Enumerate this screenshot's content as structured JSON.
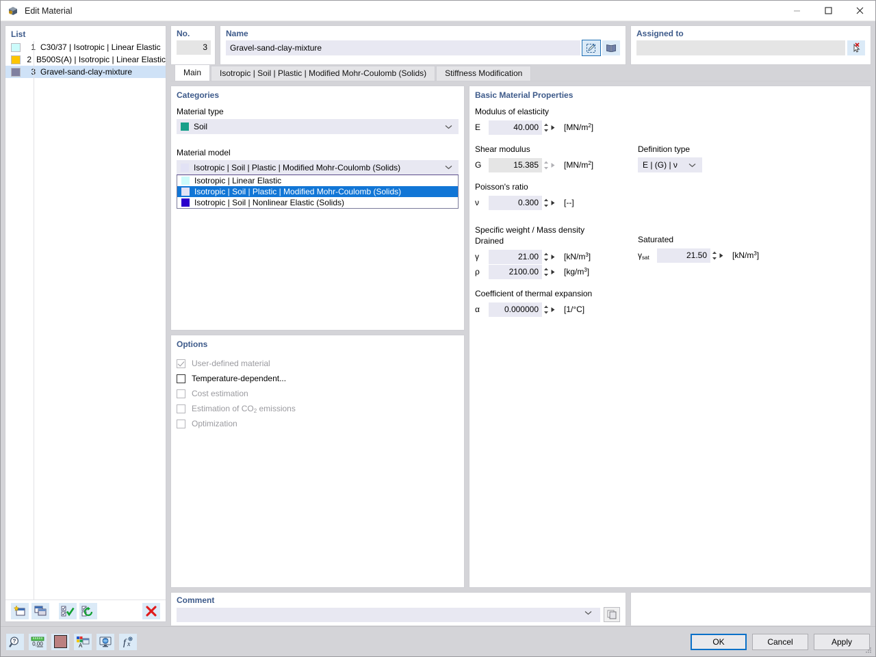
{
  "window": {
    "title": "Edit Material",
    "icon": "material-cube-icon",
    "controls": {
      "minimize": "—",
      "maximize": "☐",
      "close": "✕"
    }
  },
  "list_panel": {
    "caption": "List",
    "rows": [
      {
        "no": "1",
        "label": "C30/37 | Isotropic | Linear Elastic",
        "color": "#ccfbfb"
      },
      {
        "no": "2",
        "label": "B500S(A) | Isotropic | Linear Elastic",
        "color": "#fdc500"
      },
      {
        "no": "3",
        "label": "Gravel-sand-clay-mixture",
        "color": "#8080a0"
      }
    ],
    "selected_index": 2,
    "toolbar": [
      {
        "name": "new-material-button",
        "icon": "new-window-star-icon"
      },
      {
        "name": "copy-material-button",
        "icon": "copy-windows-icon"
      },
      {
        "name": "select-all-button",
        "icon": "checklist-check-icon"
      },
      {
        "name": "invert-selection-button",
        "icon": "checklist-refresh-icon"
      },
      {
        "name": "delete-material-button",
        "icon": "red-x-icon",
        "glyph": "✕"
      }
    ]
  },
  "header": {
    "no": {
      "caption": "No.",
      "value": "3"
    },
    "name": {
      "caption": "Name",
      "value": "Gravel-sand-clay-mixture",
      "placeholder": "",
      "buttons": [
        {
          "name": "edit-name-button",
          "icon": "pencil-edit-icon"
        },
        {
          "name": "material-library-button",
          "icon": "book-library-icon"
        }
      ]
    },
    "assigned_to": {
      "caption": "Assigned to",
      "value": "",
      "button": {
        "name": "clear-assignment-button",
        "icon": "cursor-red-x-icon"
      }
    }
  },
  "tabs": [
    {
      "label": "Main",
      "active": true
    },
    {
      "label": "Isotropic | Soil | Plastic | Modified Mohr-Coulomb (Solids)",
      "active": false
    },
    {
      "label": "Stiffness Modification",
      "active": false
    }
  ],
  "categories": {
    "caption": "Categories",
    "material_type": {
      "label": "Material type",
      "value": "Soil",
      "swatch": "#17a08a"
    },
    "material_model": {
      "label": "Material model",
      "value": "Isotropic | Soil | Plastic | Modified Mohr-Coulomb (Solids)",
      "swatch": "#e2e2f5",
      "open": true,
      "options": [
        {
          "label": "Isotropic | Linear Elastic",
          "swatch": "#ccfbfb",
          "selected": false
        },
        {
          "label": "Isotropic | Soil | Plastic | Modified Mohr-Coulomb (Solids)",
          "swatch": "#e2e2f5",
          "selected": true
        },
        {
          "label": "Isotropic | Soil | Nonlinear Elastic (Solids)",
          "swatch": "#2b00cc",
          "selected": false
        }
      ]
    }
  },
  "options": {
    "caption": "Options",
    "items": [
      {
        "label": "User-defined material",
        "checked": true,
        "disabled": true
      },
      {
        "label": "Temperature-dependent...",
        "checked": false,
        "disabled": false
      },
      {
        "label": "Cost estimation",
        "checked": false,
        "disabled": true
      },
      {
        "label": "Estimation of CO2 emissions",
        "checked": false,
        "disabled": true,
        "label_pre": "Estimation of CO",
        "label_sub": "2",
        "label_post": " emissions"
      },
      {
        "label": "Optimization",
        "checked": false,
        "disabled": true
      }
    ]
  },
  "properties": {
    "caption": "Basic Material Properties",
    "modulus": {
      "title": "Modulus of elasticity",
      "symbol": "E",
      "value": "40.000",
      "unit_pre": "[MN/m",
      "unit_sup": "2",
      "unit_post": "]",
      "readonly": false
    },
    "shear": {
      "title": "Shear modulus",
      "symbol": "G",
      "value": "15.385",
      "unit_pre": "[MN/m",
      "unit_sup": "2",
      "unit_post": "]",
      "readonly": true
    },
    "definition_type": {
      "title": "Definition type",
      "value": "E | (G) | ν"
    },
    "poisson": {
      "title": "Poisson's ratio",
      "symbol": "ν",
      "value": "0.300",
      "unit": "[--]"
    },
    "density": {
      "title": "Specific weight / Mass density",
      "drained_label": "Drained",
      "saturated_label": "Saturated",
      "gamma": {
        "symbol": "γ",
        "value": "21.00",
        "unit_pre": "[kN/m",
        "unit_sup": "3",
        "unit_post": "]"
      },
      "rho": {
        "symbol": "ρ",
        "value": "2100.00",
        "unit_pre": "[kg/m",
        "unit_sup": "3",
        "unit_post": "]"
      },
      "gamma_sat": {
        "symbol_pre": "γ",
        "symbol_sub": "sat",
        "value": "21.50",
        "unit_pre": "[kN/m",
        "unit_sup": "3",
        "unit_post": "]"
      }
    },
    "thermal": {
      "title": "Coefficient of thermal expansion",
      "symbol": "α",
      "value": "0.000000",
      "unit": "[1/°C]"
    }
  },
  "comment": {
    "caption": "Comment",
    "value": "",
    "placeholder": "",
    "button": {
      "name": "comment-library-button",
      "icon": "copy-pages-icon"
    }
  },
  "footer": {
    "tools": [
      {
        "name": "help-button",
        "icon": "help-magnifier-icon"
      },
      {
        "name": "units-button",
        "icon": "units-ruler-icon",
        "glyph": "0,00"
      },
      {
        "name": "color-button",
        "icon": "color-swatch-icon",
        "color": "#bb8080"
      },
      {
        "name": "display-properties-button",
        "icon": "color-label-icon"
      },
      {
        "name": "visual-button",
        "icon": "monitor-globe-icon"
      },
      {
        "name": "formula-button",
        "icon": "function-fx-icon",
        "glyph": "ƒx"
      }
    ],
    "buttons": {
      "ok": "OK",
      "cancel": "Cancel",
      "apply": "Apply"
    }
  }
}
